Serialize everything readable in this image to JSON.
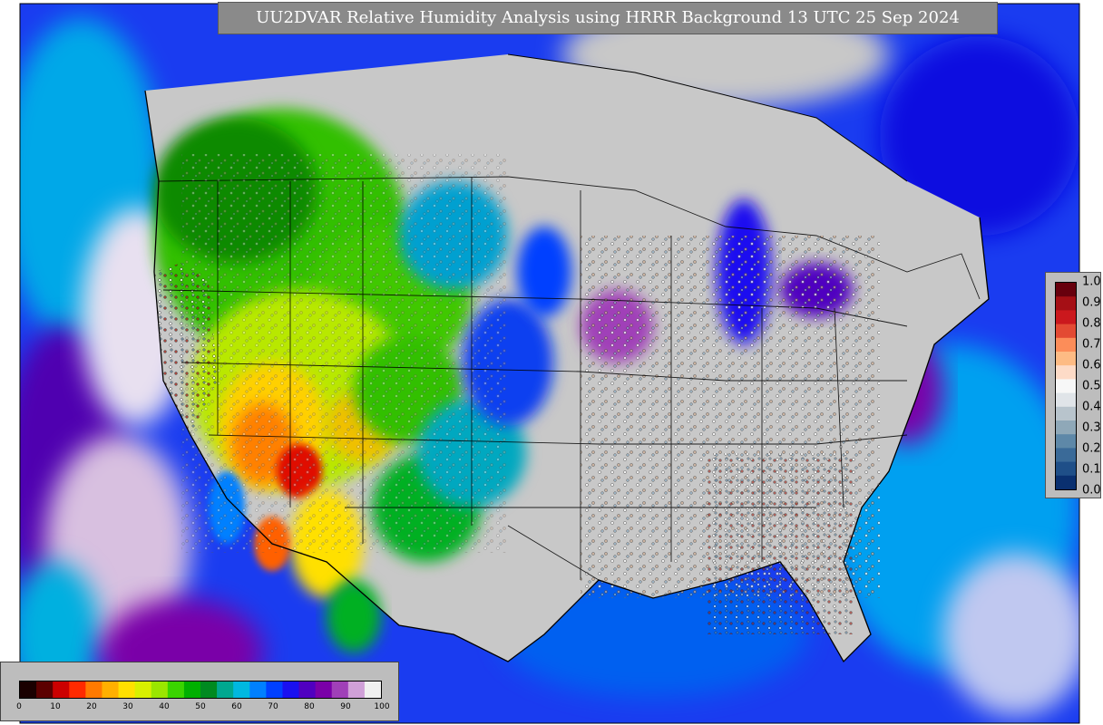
{
  "title": "UU2DVAR Relative Humidity Analysis using HRRR Background 13 UTC 25 Sep 2024",
  "rh_legend": {
    "ticks": [
      "0",
      "10",
      "20",
      "30",
      "40",
      "50",
      "60",
      "70",
      "80",
      "90",
      "100"
    ],
    "colors": [
      "#1a0000",
      "#5c0000",
      "#cc0000",
      "#ff2a00",
      "#ff7a00",
      "#ffb000",
      "#ffe000",
      "#d8f000",
      "#9ae600",
      "#3ad400",
      "#00b000",
      "#008a20",
      "#00a890",
      "#00b8e0",
      "#0080ff",
      "#0040ff",
      "#1a10f0",
      "#5000c0",
      "#7a00a8",
      "#a040b8",
      "#d0a0d8",
      "#f0f0f0"
    ]
  },
  "ratio_legend": {
    "ticks": [
      "1.0",
      "0.9",
      "0.8",
      "0.7",
      "0.6",
      "0.5",
      "0.4",
      "0.3",
      "0.2",
      "0.1",
      "0.0"
    ],
    "colors": [
      "#67000d",
      "#a50f15",
      "#cb181d",
      "#e34a33",
      "#fc8d59",
      "#fdbb84",
      "#fddbc7",
      "#f7f7f7",
      "#e0e4e8",
      "#b8c4cc",
      "#8fa8b8",
      "#5e88a8",
      "#3a6a98",
      "#1f4f88",
      "#0a3070"
    ]
  }
}
